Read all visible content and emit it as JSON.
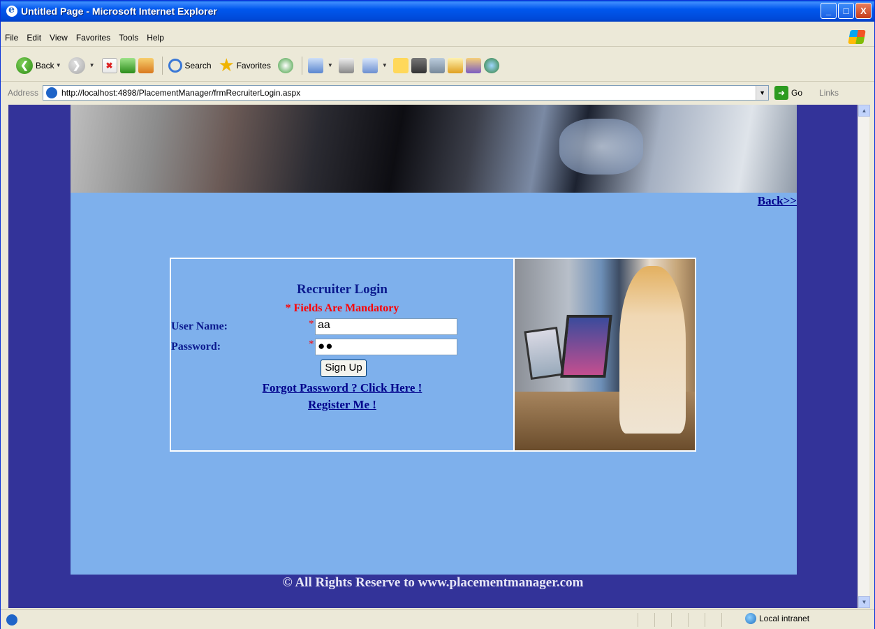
{
  "window": {
    "title": "Untitled Page - Microsoft Internet Explorer",
    "buttons": [
      "_",
      "□",
      "X"
    ]
  },
  "menu": [
    "File",
    "Edit",
    "View",
    "Favorites",
    "Tools",
    "Help"
  ],
  "toolbar": {
    "back_label": "Back",
    "search_label": "Search",
    "favorites_label": "Favorites"
  },
  "address": {
    "label": "Address",
    "url": "http://localhost:4898/PlacementManager/frmRecruiterLogin.aspx",
    "go_label": "Go",
    "links_label": "Links"
  },
  "page": {
    "back_link": "Back>>",
    "login": {
      "title": "Recruiter Login",
      "mandatory": "* Fields Are Mandatory",
      "username_label": "User Name:",
      "password_label": "Password:",
      "star": "*",
      "username_value": "aa",
      "password_value": "●●",
      "signup_label": "Sign Up",
      "forgot_link": "Forgot Password ? Click Here !",
      "register_link": "Register Me !"
    },
    "footer": "© All Rights Reserve to www.placementmanager.com"
  },
  "status": {
    "zone": "Local intranet"
  },
  "colors": {
    "page_border": "#333399",
    "panel": "#7eb0ec",
    "title_text": "#0b1a8e",
    "mandatory": "#ff0000"
  }
}
